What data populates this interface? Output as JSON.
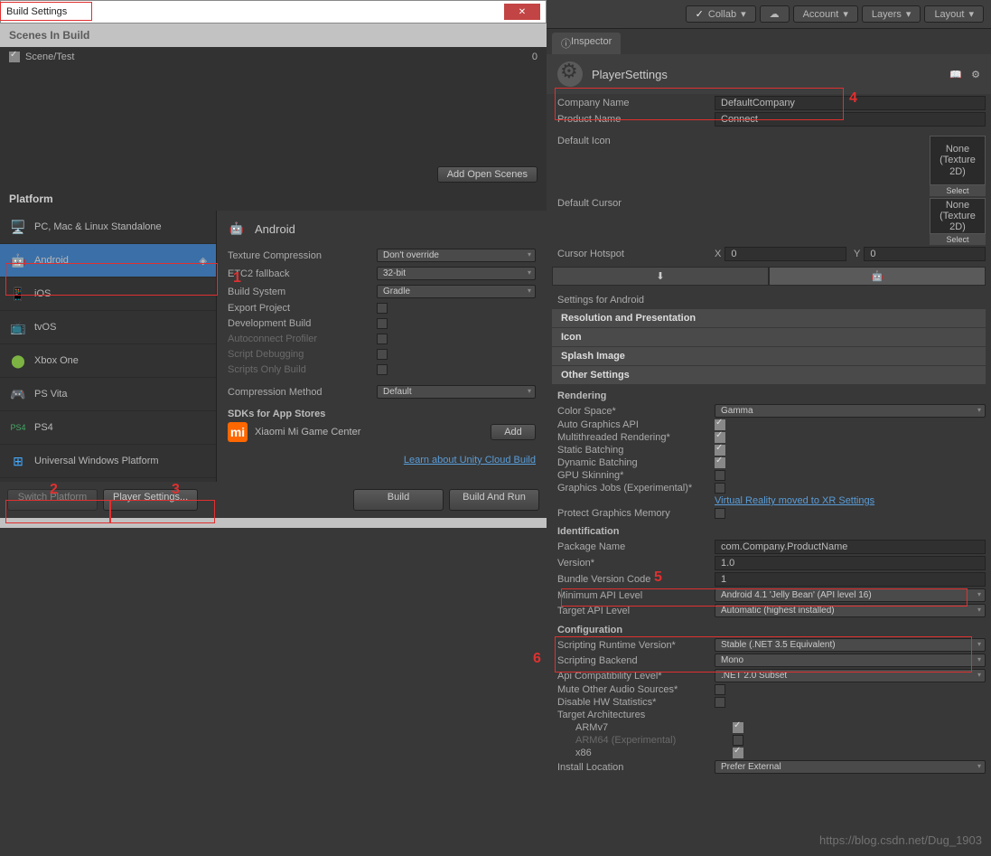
{
  "buildWindow": {
    "title": "Build Settings",
    "scenesHeader": "Scenes In Build",
    "scenes": [
      {
        "name": "Scene/Test",
        "index": "0"
      }
    ],
    "addOpenScenes": "Add Open Scenes",
    "platformHeader": "Platform",
    "platforms": [
      {
        "name": "PC, Mac & Linux Standalone",
        "icon": "🖥️"
      },
      {
        "name": "Android",
        "icon": "🤖",
        "selected": true
      },
      {
        "name": "iOS",
        "icon": "📱"
      },
      {
        "name": "tvOS",
        "icon": "📺"
      },
      {
        "name": "Xbox One",
        "icon": "🟢"
      },
      {
        "name": "PS Vita",
        "icon": "🎮"
      },
      {
        "name": "PS4",
        "icon": "🎮"
      },
      {
        "name": "Universal Windows Platform",
        "icon": "🪟"
      }
    ],
    "detail": {
      "title": "Android",
      "icon": "🤖",
      "texCompression": {
        "label": "Texture Compression",
        "value": "Don't override"
      },
      "etc2": {
        "label": "ETC2 fallback",
        "value": "32-bit"
      },
      "buildSystem": {
        "label": "Build System",
        "value": "Gradle"
      },
      "exportProject": "Export Project",
      "devBuild": "Development Build",
      "autoconnect": "Autoconnect Profiler",
      "scriptDebug": "Script Debugging",
      "scriptsOnly": "Scripts Only Build",
      "compMethod": {
        "label": "Compression Method",
        "value": "Default"
      },
      "sdkHeader": "SDKs for App Stores",
      "xiaomi": "Xiaomi Mi Game Center",
      "add": "Add",
      "cloudLink": "Learn about Unity Cloud Build"
    },
    "switchPlatform": "Switch Platform",
    "playerSettings": "Player Settings...",
    "build": "Build",
    "buildAndRun": "Build And Run"
  },
  "toolbar": {
    "collab": "Collab",
    "account": "Account",
    "layers": "Layers",
    "layout": "Layout"
  },
  "inspector": {
    "tab": "Inspector",
    "title": "PlayerSettings",
    "companyName": {
      "label": "Company Name",
      "value": "DefaultCompany"
    },
    "productName": {
      "label": "Product Name",
      "value": "Connect"
    },
    "defaultIcon": "Default Icon",
    "defaultCursor": "Default Cursor",
    "texNone": "None\n(Texture 2D)",
    "select": "Select",
    "cursorHotspot": {
      "label": "Cursor Hotspot",
      "x": "X",
      "xv": "0",
      "y": "Y",
      "yv": "0"
    },
    "settingsFor": "Settings for Android",
    "sections": [
      "Resolution and Presentation",
      "Icon",
      "Splash Image",
      "Other Settings"
    ],
    "rendering": {
      "header": "Rendering",
      "colorSpace": {
        "label": "Color Space*",
        "value": "Gamma"
      },
      "autoGraphics": {
        "label": "Auto Graphics API"
      },
      "multithreaded": {
        "label": "Multithreaded Rendering*"
      },
      "staticBatch": {
        "label": "Static Batching"
      },
      "dynamicBatch": {
        "label": "Dynamic Batching"
      },
      "gpuSkin": {
        "label": "GPU Skinning*"
      },
      "graphicsJobs": {
        "label": "Graphics Jobs (Experimental)*"
      },
      "vrLink": "Virtual Reality moved to XR Settings",
      "protectMem": {
        "label": "Protect Graphics Memory"
      }
    },
    "identification": {
      "header": "Identification",
      "packageName": {
        "label": "Package Name",
        "value": "com.Company.ProductName"
      },
      "version": {
        "label": "Version*",
        "value": "1.0"
      },
      "bundleCode": {
        "label": "Bundle Version Code",
        "value": "1"
      },
      "minApi": {
        "label": "Minimum API Level",
        "value": "Android 4.1 'Jelly Bean' (API level 16)"
      },
      "targetApi": {
        "label": "Target API Level",
        "value": "Automatic (highest installed)"
      }
    },
    "configuration": {
      "header": "Configuration",
      "runtime": {
        "label": "Scripting Runtime Version*",
        "value": "Stable (.NET 3.5 Equivalent)"
      },
      "backend": {
        "label": "Scripting Backend",
        "value": "Mono"
      },
      "apiCompat": {
        "label": "Api Compatibility Level*",
        "value": ".NET 2.0 Subset"
      },
      "muteAudio": {
        "label": "Mute Other Audio Sources*"
      },
      "disableHW": {
        "label": "Disable HW Statistics*"
      },
      "targetArch": {
        "label": "Target Architectures"
      },
      "armv7": "ARMv7",
      "arm64": "ARM64 (Experimental)",
      "x86": "x86",
      "installLoc": {
        "label": "Install Location",
        "value": "Prefer External"
      }
    }
  },
  "annotations": {
    "1": "1",
    "2": "2",
    "3": "3",
    "4": "4",
    "5": "5",
    "6": "6"
  },
  "watermark": "https://blog.csdn.net/Dug_1903"
}
